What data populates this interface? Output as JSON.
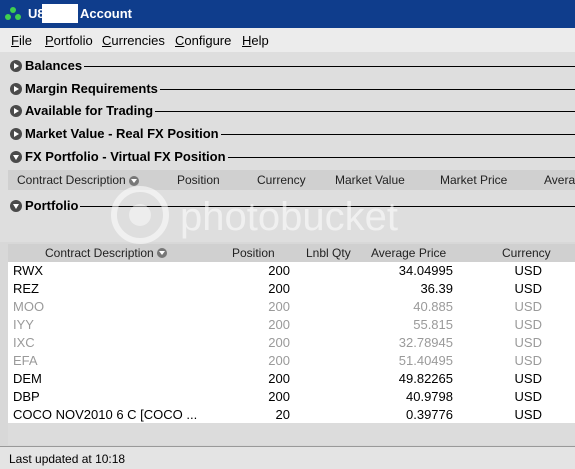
{
  "window": {
    "title_prefix": "U8",
    "title_suffix": "Account"
  },
  "menu": {
    "items": [
      {
        "first": "F",
        "rest": "ile"
      },
      {
        "first": "P",
        "rest": "ortfolio"
      },
      {
        "first": "C",
        "rest": "urrencies"
      },
      {
        "first": "C",
        "rest": "onfigure"
      },
      {
        "first": "H",
        "rest": "elp"
      }
    ]
  },
  "sections": {
    "balances": "Balances",
    "margin": "Margin Requirements",
    "available": "Available for Trading",
    "market_value": "Market Value - Real FX Position",
    "fx_portfolio": "FX Portfolio - Virtual FX Position",
    "portfolio": "Portfolio"
  },
  "fx_columns": [
    "Contract Description",
    "Position",
    "Currency",
    "Market Value",
    "Market Price",
    "Avera"
  ],
  "portfolio_columns": [
    "Contract Description",
    "Position",
    "Lnbl Qty",
    "Average Price",
    "Currency"
  ],
  "rows": [
    {
      "desc": "RWX",
      "pos": "200",
      "avg": "34.04995",
      "cur": "USD",
      "dim": false
    },
    {
      "desc": "REZ",
      "pos": "200",
      "avg": "36.39",
      "cur": "USD",
      "dim": false
    },
    {
      "desc": "MOO",
      "pos": "200",
      "avg": "40.885",
      "cur": "USD",
      "dim": true
    },
    {
      "desc": "IYY",
      "pos": "200",
      "avg": "55.815",
      "cur": "USD",
      "dim": true
    },
    {
      "desc": "IXC",
      "pos": "200",
      "avg": "32.78945",
      "cur": "USD",
      "dim": true
    },
    {
      "desc": "EFA",
      "pos": "200",
      "avg": "51.40495",
      "cur": "USD",
      "dim": true
    },
    {
      "desc": "DEM",
      "pos": "200",
      "avg": "49.82265",
      "cur": "USD",
      "dim": false
    },
    {
      "desc": "DBP",
      "pos": "200",
      "avg": "40.9798",
      "cur": "USD",
      "dim": false
    },
    {
      "desc": "COCO    NOV2010 6 C [COCO    ...",
      "pos": "20",
      "avg": "0.39776",
      "cur": "USD",
      "dim": false
    }
  ],
  "status": "Last updated at 10:18",
  "watermark": "photobucket",
  "colors": {
    "titlebar": "#0f3d8c",
    "logo": "#3fcf4f"
  }
}
